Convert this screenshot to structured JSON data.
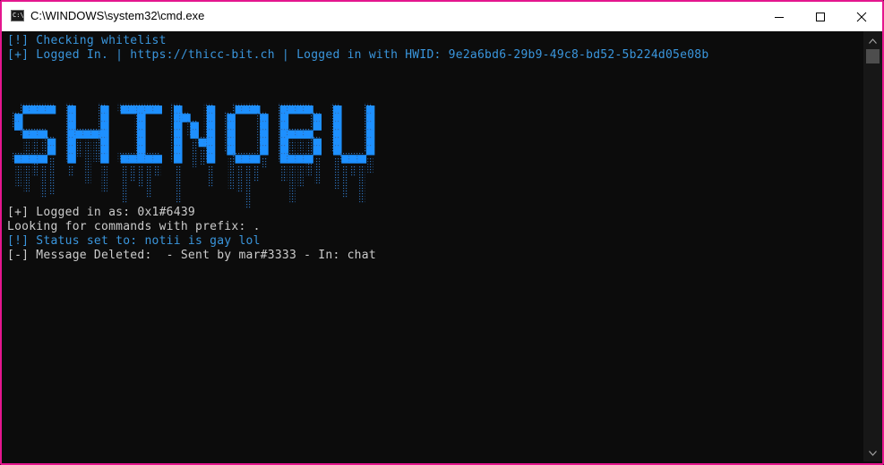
{
  "window": {
    "title": "C:\\WINDOWS\\system32\\cmd.exe",
    "icon": "cmd-icon",
    "icon_text": "C:\\",
    "frame_color": "#e4168e",
    "controls": [
      "minimize-icon",
      "maximize-icon",
      "close-icon"
    ]
  },
  "console": {
    "background": "#0c0c0c",
    "lines_top": [
      {
        "text": "[!] Checking whitelist",
        "color": "#3a96dd"
      },
      {
        "text": "[+] Logged In. | https://thicc-bit.ch | Logged in with HWID: 9e2a6bd6-29b9-49c8-bd52-5b224d05e08b",
        "color": "#3a96dd"
      }
    ],
    "banner": {
      "text": "SHINOBU",
      "color": "#1e90ff",
      "drip_color": "#2d6fb8"
    },
    "lines_bottom": [
      {
        "text": "[+] Logged in as: 0x1#6439",
        "color": "#cccccc"
      },
      {
        "text": "Looking for commands with prefix: .",
        "color": "#cccccc"
      },
      {
        "text": "[!] Status set to: notii is gay lol",
        "color": "#3a96dd"
      },
      {
        "text": "[-] Message Deleted:  - Sent by mar#3333 - In: chat",
        "color": "#cccccc"
      }
    ]
  }
}
